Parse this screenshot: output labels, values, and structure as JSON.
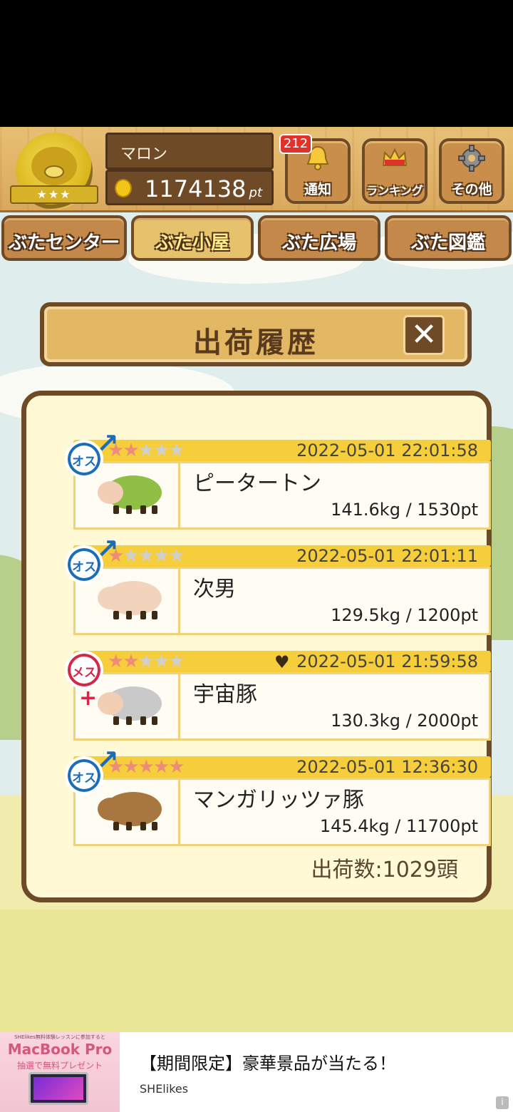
{
  "header": {
    "player_name": "マロン",
    "points": "1174138",
    "points_unit": "pt",
    "notification_count": "212",
    "buttons": [
      {
        "label": "通知",
        "icon": "bell-icon"
      },
      {
        "label": "ランキング",
        "icon": "crown-icon"
      },
      {
        "label": "その他",
        "icon": "gear-icon"
      }
    ]
  },
  "nav": {
    "tabs": [
      {
        "label": "ぶたセンター"
      },
      {
        "label": "ぶた小屋"
      },
      {
        "label": "ぶた広場"
      },
      {
        "label": "ぶた図鑑"
      }
    ],
    "active_tab": "ぶた小屋"
  },
  "dialog": {
    "title": "出荷履歴",
    "close_label": "✕",
    "entries": [
      {
        "sex": "オス",
        "stars": 2,
        "date": "2022-05-01 22:01:58",
        "name": "ピータートン",
        "stat": "141.6kg / 1530pt",
        "favorite": false
      },
      {
        "sex": "オス",
        "stars": 1,
        "date": "2022-05-01 22:01:11",
        "name": "次男",
        "stat": "129.5kg / 1200pt",
        "favorite": false
      },
      {
        "sex": "メス",
        "stars": 2,
        "date": "2022-05-01 21:59:58",
        "name": "宇宙豚",
        "stat": "130.3kg / 2000pt",
        "favorite": true
      },
      {
        "sex": "オス",
        "stars": 5,
        "date": "2022-05-01 12:36:30",
        "name": "マンガリッツァ豚",
        "stat": "145.4kg / 11700pt",
        "favorite": false
      }
    ],
    "total": "出荷数:1029頭"
  },
  "ad": {
    "image_small_text": "SHElikes無料体験レッスンに参加すると",
    "image_headline": "MacBook Pro",
    "image_sub": "抽選で無料プレゼント",
    "title": "【期間限定】豪華景品が当たる！",
    "sponsor": "SHElikes",
    "info_label": "i"
  },
  "colors": {
    "wood": "#c4884a",
    "wood_dark": "#6e4a27",
    "panel": "#fff9d6",
    "header_bar": "#f6cd3a",
    "male": "#1d6cb8",
    "female": "#d4284b",
    "star_on": "#ee8c7a",
    "grass": "#eae698"
  }
}
